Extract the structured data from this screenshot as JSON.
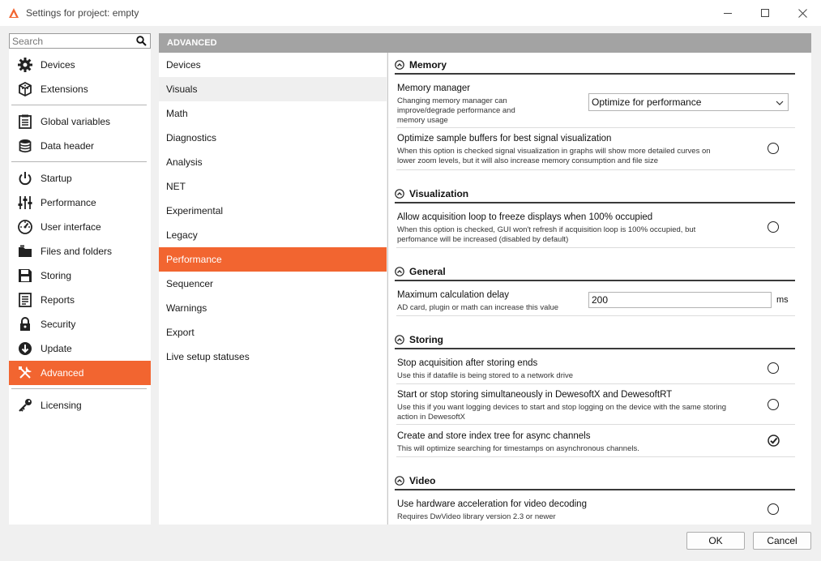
{
  "window": {
    "title": "Settings for project: empty",
    "minimize_icon": "minimize-icon",
    "maximize_icon": "maximize-icon",
    "close_icon": "close-icon"
  },
  "search": {
    "placeholder": "Search",
    "value": ""
  },
  "nav": {
    "items": [
      {
        "label": "Devices",
        "icon": "gear-icon"
      },
      {
        "label": "Extensions",
        "icon": "cube-icon"
      },
      {
        "label": "Global variables",
        "icon": "list-icon"
      },
      {
        "label": "Data header",
        "icon": "database-icon"
      },
      {
        "label": "Startup",
        "icon": "power-icon"
      },
      {
        "label": "Performance",
        "icon": "sliders-icon"
      },
      {
        "label": "User interface",
        "icon": "gauge-icon"
      },
      {
        "label": "Files and folders",
        "icon": "folder-icon"
      },
      {
        "label": "Storing",
        "icon": "floppy-icon"
      },
      {
        "label": "Reports",
        "icon": "report-icon"
      },
      {
        "label": "Security",
        "icon": "lock-icon"
      },
      {
        "label": "Update",
        "icon": "update-icon"
      },
      {
        "label": "Advanced",
        "icon": "tools-icon",
        "active": true
      },
      {
        "label": "Licensing",
        "icon": "key-icon"
      }
    ]
  },
  "advanced": {
    "header": "ADVANCED",
    "subitems": [
      "Devices",
      "Visuals",
      "Math",
      "Diagnostics",
      "Analysis",
      "NET",
      "Experimental",
      "Legacy",
      "Performance",
      "Sequencer",
      "Warnings",
      "Export",
      "Live setup statuses"
    ],
    "active_subitem": "Performance"
  },
  "content": {
    "memory": {
      "title": "Memory",
      "manager_title": "Memory manager",
      "manager_desc": "Changing memory manager can improve/degrade performance and memory usage",
      "manager_value": "Optimize for performance",
      "optimize_title": "Optimize sample buffers for best signal visualization",
      "optimize_desc": "When this option is checked signal visualization in graphs will show more detailed curves on lower zoom levels, but it will also increase memory consumption and file size"
    },
    "visualization": {
      "title": "Visualization",
      "freeze_title": "Allow acquisition loop to freeze displays when 100% occupied",
      "freeze_desc": "When this option is checked, GUI won't refresh if acquisition loop is 100% occupied, but perfomance will be increased (disabled by default)"
    },
    "general": {
      "title": "General",
      "delay_title": "Maximum calculation delay",
      "delay_desc": "AD card, plugin or math can increase this value",
      "delay_value": "200",
      "delay_unit": "ms"
    },
    "storing": {
      "title": "Storing",
      "stop_title": "Stop acquisition after storing ends",
      "stop_desc": "Use this if datafile is being stored to a network drive",
      "sim_title": "Start or stop storing simultaneously in DewesoftX and DewesoftRT",
      "sim_desc": "Use this if you want logging devices to start and stop logging on the device with the same storing action in DewesoftX",
      "index_title": "Create and store index tree for async channels",
      "index_desc": "This will optimize searching for timestamps on asynchronous channels."
    },
    "video": {
      "title": "Video",
      "hw_title": "Use hardware acceleration for video decoding",
      "hw_desc": "Requires DwVideo library version 2.3 or newer"
    }
  },
  "footer": {
    "ok": "OK",
    "cancel": "Cancel"
  },
  "colors": {
    "accent": "#f26530",
    "header_gray": "#a3a3a3"
  }
}
